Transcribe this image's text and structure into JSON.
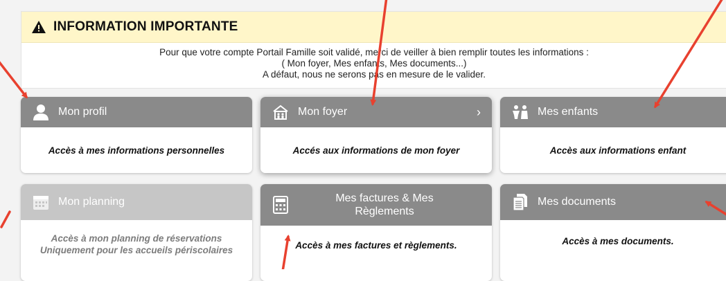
{
  "banner": {
    "title": "INFORMATION IMPORTANTE",
    "line1": "Pour que votre compte Portail Famille soit validé, merci de veiller à bien remplir toutes les informations :",
    "line2": "( Mon foyer, Mes enfants, Mes documents...)",
    "line3": "A défaut, nous ne serons pas en mesure de le valider.",
    "icon": "warning-icon"
  },
  "cards": {
    "profil": {
      "title": "Mon profil",
      "desc": "Accès à mes informations personnelles",
      "icon": "user-icon"
    },
    "foyer": {
      "title": "Mon foyer",
      "desc": "Accés aux informations de mon foyer",
      "icon": "house-icon"
    },
    "enfants": {
      "title": "Mes enfants",
      "desc": "Accès aux informations enfant",
      "icon": "children-icon"
    },
    "planning": {
      "title": "Mon planning",
      "desc_line1": "Accès à mon planning de réservations",
      "desc_line2": "Uniquement pour les accueils périscolaires",
      "icon": "calendar-icon"
    },
    "factures": {
      "title_line1": "Mes factures & Mes",
      "title_line2": "Règlements",
      "desc": "Accès à mes factures et règlements.",
      "icon": "calculator-icon"
    },
    "documents": {
      "title": "Mes documents",
      "desc": "Accès à mes documents.",
      "icon": "documents-icon"
    }
  },
  "colors": {
    "card_header": "#8a8a8a",
    "card_header_disabled": "#c6c6c6",
    "banner_bg": "#fff6c9",
    "annotation_arrow": "#e8412f"
  }
}
